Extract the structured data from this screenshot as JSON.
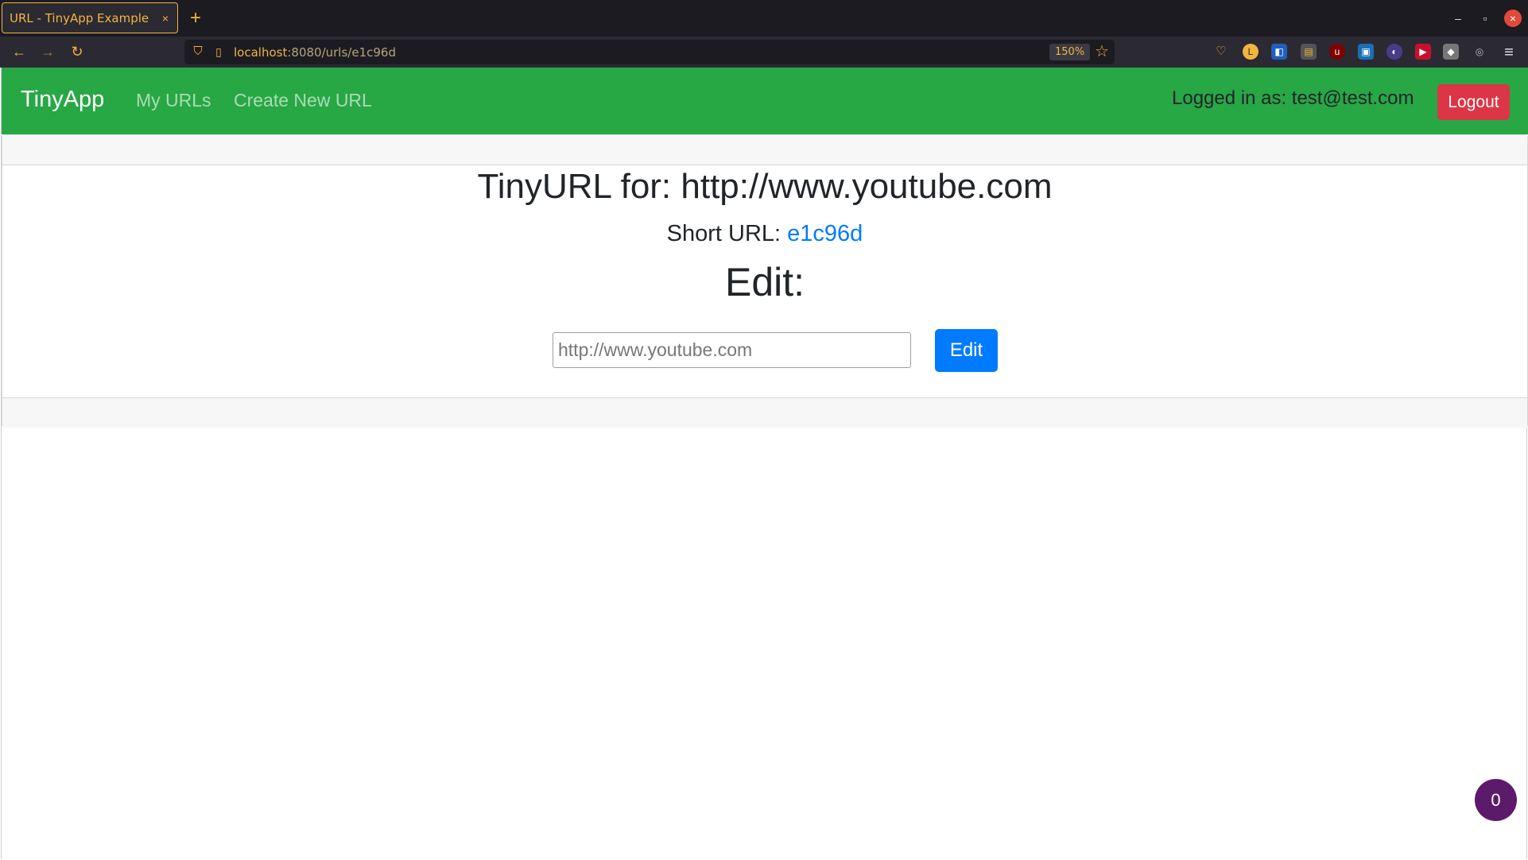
{
  "browser": {
    "tab_title": "URL - TinyApp Example",
    "tab_close": "×",
    "new_tab": "+",
    "url_host": "localhost",
    "url_path": ":8080/urls/e1c96d",
    "zoom": "150%",
    "icons": [
      "back-icon",
      "forward-icon",
      "reload-icon",
      "shield-icon",
      "page-icon",
      "bookmark-star-icon",
      "pocket-icon",
      "menu-icon"
    ],
    "accent_color": "#f2b53d"
  },
  "navbar": {
    "brand": "TinyApp",
    "links": [
      "My URLs",
      "Create New URL"
    ],
    "logged_in_text": "Logged in as: test@test.com",
    "logout_label": "Logout",
    "bg_color": "#28a745"
  },
  "main": {
    "title": "TinyURL for: http://www.youtube.com",
    "short_url_label": "Short URL:",
    "short_url_value": "e1c96d",
    "edit_heading": "Edit:",
    "input_placeholder": "http://www.youtube.com",
    "edit_button": "Edit"
  },
  "floating_badge": "0"
}
